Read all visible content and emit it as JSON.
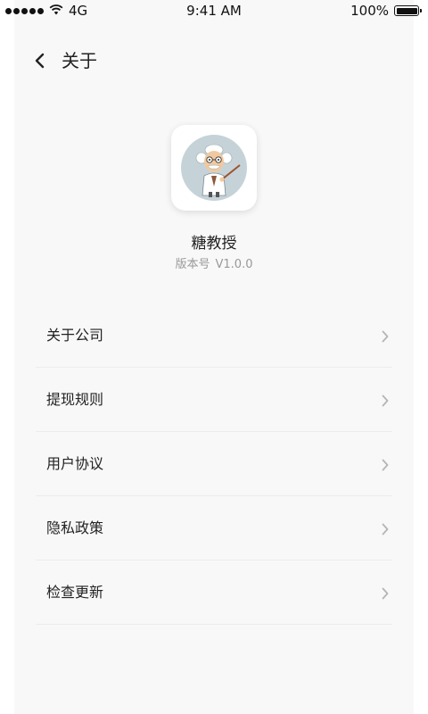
{
  "status_bar": {
    "carrier": "4G",
    "time": "9:41 AM",
    "battery": "100%"
  },
  "nav": {
    "title": "关于"
  },
  "app": {
    "name": "糖教授",
    "version_label": "版本号",
    "version": "V1.0.0"
  },
  "menu": {
    "items": [
      {
        "label": "关于公司"
      },
      {
        "label": "提现规则"
      },
      {
        "label": "用户协议"
      },
      {
        "label": "隐私政策"
      },
      {
        "label": "检查更新"
      }
    ]
  },
  "icons": {
    "back": "chevron-left-icon",
    "item": "chevron-right-icon",
    "logo": "professor-avatar-icon"
  },
  "colors": {
    "background": "#f8f8f8",
    "divider": "#ececec",
    "secondary_text": "#999999",
    "logo_bg": "#c5d3d9"
  }
}
